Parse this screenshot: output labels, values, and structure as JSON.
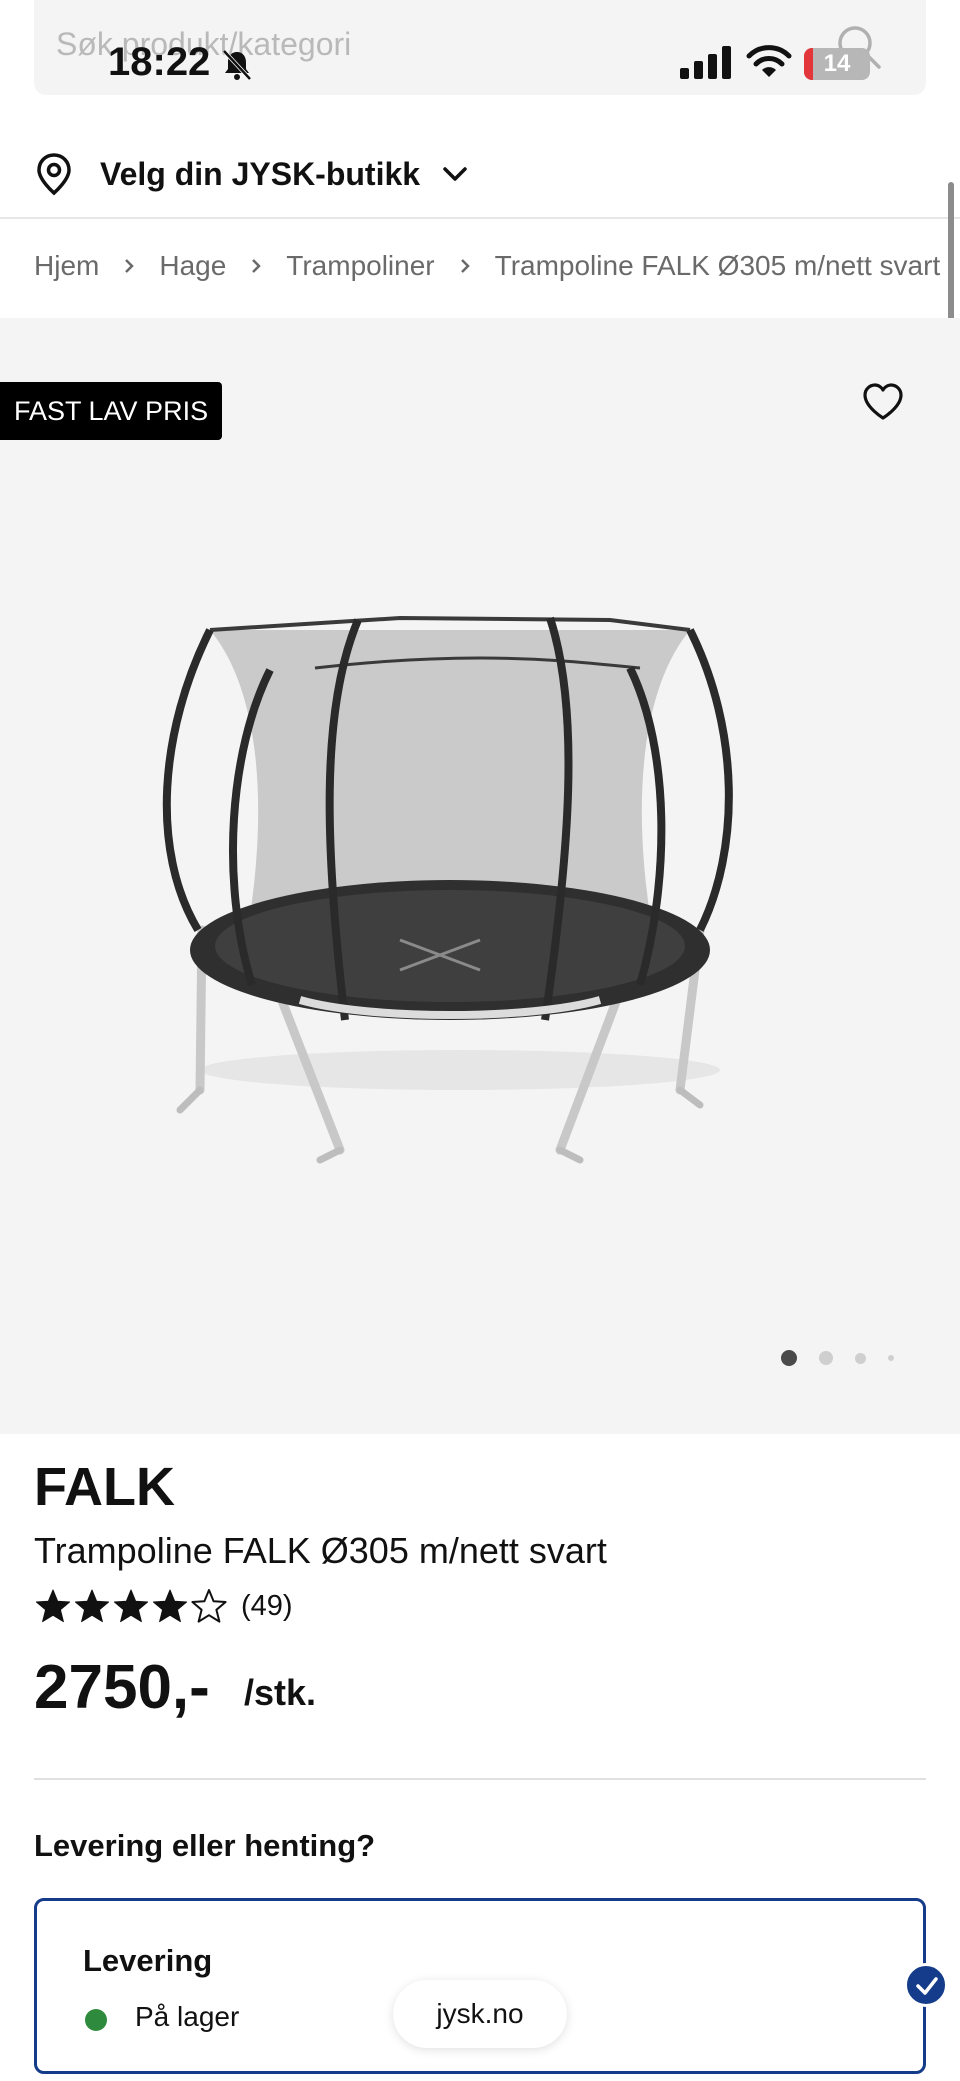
{
  "search": {
    "placeholder": "Søk produkt/kategori",
    "icon": "search-icon"
  },
  "status_bar": {
    "time": "18:22",
    "battery": "14",
    "battery_level": 0.14,
    "battery_color": "#e3363b"
  },
  "store": {
    "label": "Velg din JYSK-butikk"
  },
  "breadcrumb": {
    "items": [
      "Hjem",
      "Hage",
      "Trampoliner",
      "Trampoline FALK Ø305 m/nett svart"
    ]
  },
  "gallery": {
    "badge": "FAST LAV PRIS",
    "image_alt": "Trampoline FALK Ø305 m/nett svart",
    "active_dot": 0,
    "dot_count": 4
  },
  "product": {
    "brand": "FALK",
    "name": "Trampoline FALK Ø305 m/nett svart",
    "rating": 4,
    "rating_max": 5,
    "review_count": "(49)",
    "price": "2750,-",
    "unit": "/stk."
  },
  "delivery": {
    "question": "Levering eller henting?",
    "option_title": "Levering",
    "stock_status": "På lager",
    "stock_color": "#2e8b3e",
    "accent_color": "#143c8a"
  },
  "browser": {
    "url": "jysk.no"
  }
}
